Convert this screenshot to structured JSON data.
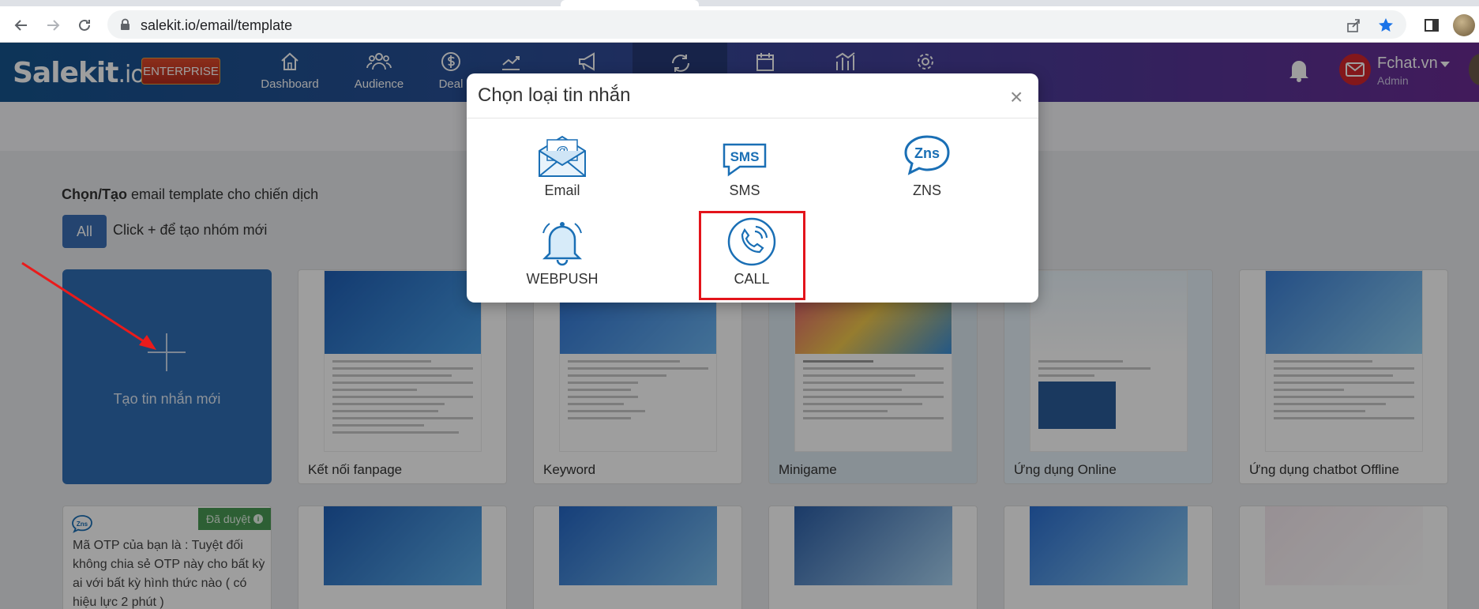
{
  "browser": {
    "url": "salekit.io/email/template"
  },
  "app": {
    "logo": "Salekit",
    "logo_suffix": ".io",
    "badge": "ENTERPRISE",
    "nav": [
      {
        "label": "Dashboard"
      },
      {
        "label": "Audience"
      },
      {
        "label": "Deal"
      }
    ],
    "user": {
      "name": "Fchat.vn",
      "role": "Admin"
    }
  },
  "content": {
    "title_bold": "Chọn/Tạo",
    "title_rest": " email template cho chiến dịch",
    "filter_all": "All",
    "hint": "Click + để tạo nhóm mới",
    "create_label": "Tạo tin nhắn mới",
    "templates": [
      {
        "name": "Kết nối fanpage"
      },
      {
        "name": "Keyword"
      },
      {
        "name": "Minigame"
      },
      {
        "name": "Ứng dụng Online"
      },
      {
        "name": "Ứng dụng chatbot Offline"
      }
    ],
    "otp_card": {
      "status": "Đã duyệt",
      "text": "Mã OTP của bạn là : Tuyệt đối không chia sẻ OTP này cho bất kỳ ai với bất kỳ hình thức nào ( có hiệu lực 2 phút )"
    }
  },
  "modal": {
    "title": "Chọn loại tin nhắn",
    "close": "×",
    "options": [
      {
        "label": "Email",
        "icon": "email-envelope-icon"
      },
      {
        "label": "SMS",
        "icon": "sms-bubble-icon"
      },
      {
        "label": "ZNS",
        "icon": "zns-bubble-icon"
      },
      {
        "label": "WEBPUSH",
        "icon": "bell-icon"
      },
      {
        "label": "CALL",
        "icon": "phone-call-icon"
      }
    ]
  },
  "colors": {
    "accent": "#1a6fb5",
    "highlight": "#e3141b",
    "approved": "#4a9a54"
  }
}
